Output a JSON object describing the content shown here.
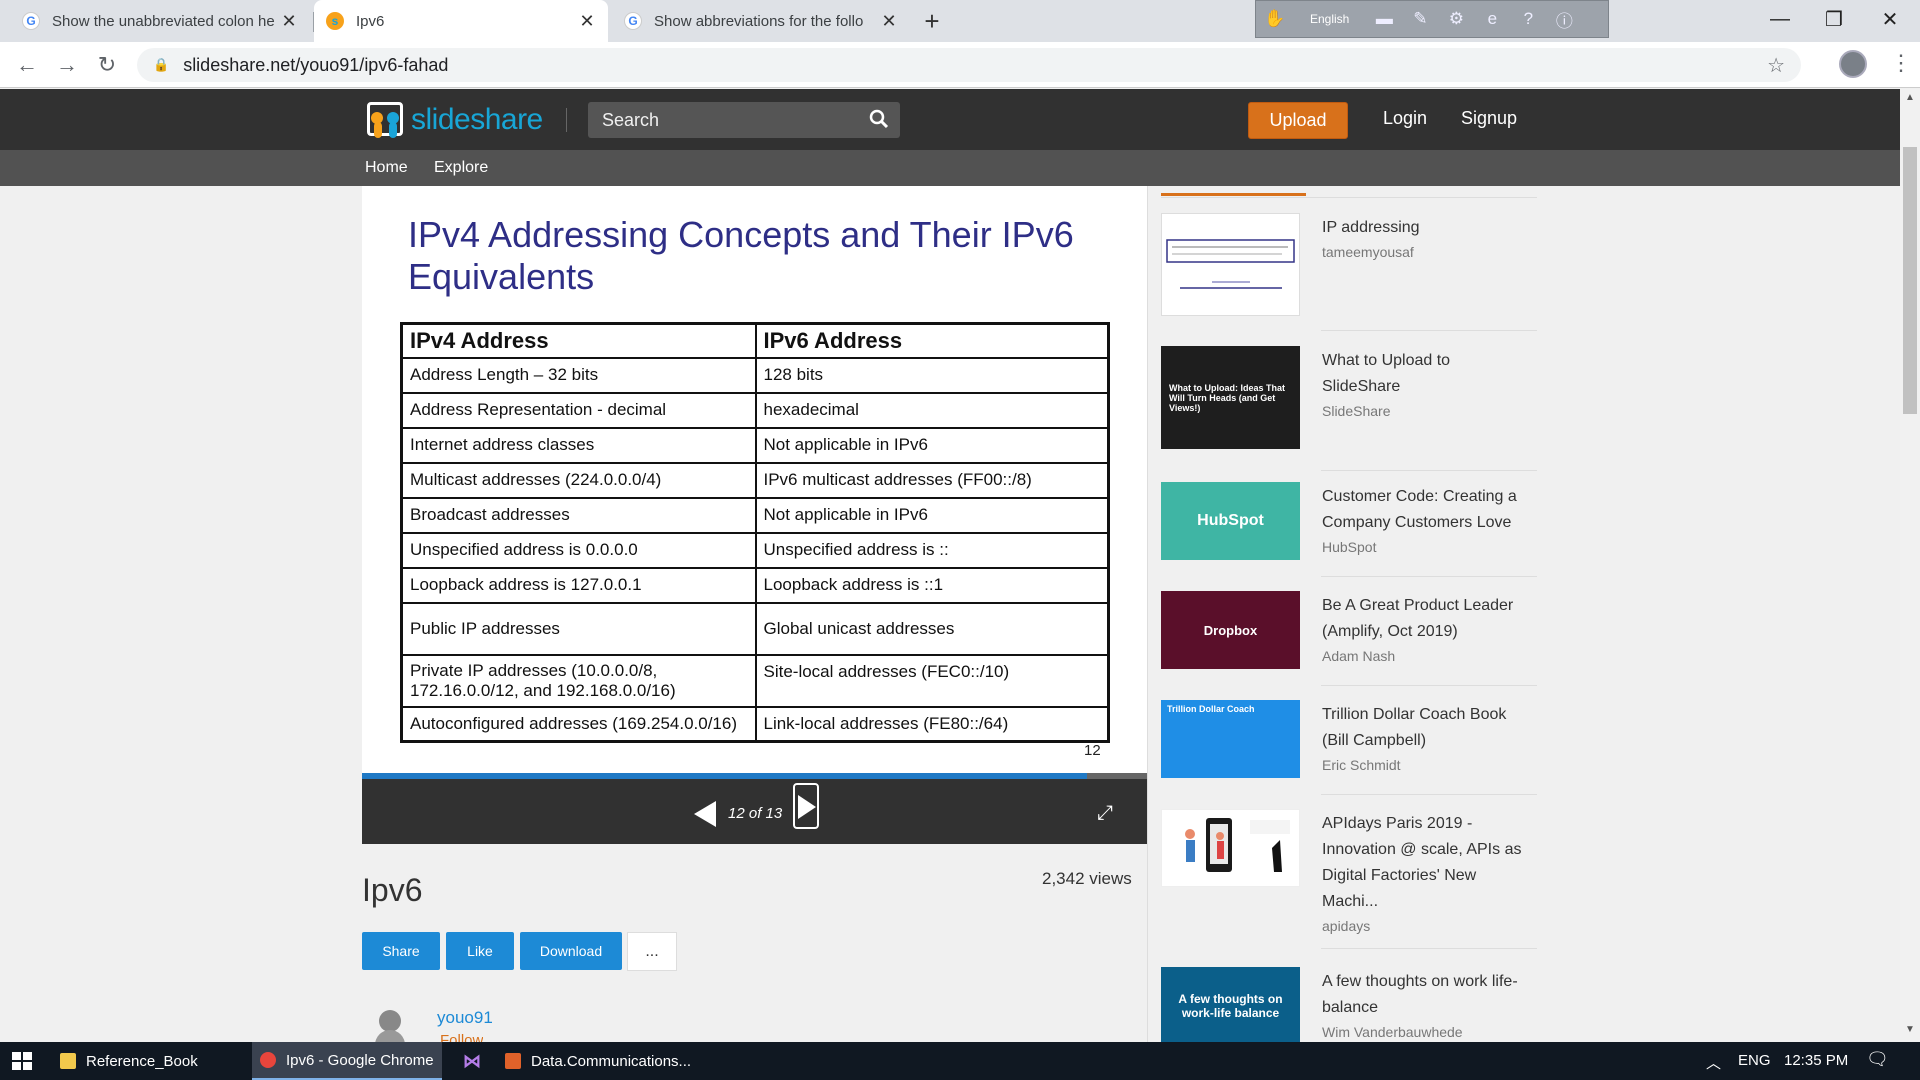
{
  "browser": {
    "tabs": [
      {
        "title": "Show the unabbreviated colon he",
        "favicon": "google-icon",
        "active": false
      },
      {
        "title": "Ipv6",
        "favicon": "slideshare-icon",
        "active": true
      },
      {
        "title": "Show abbreviations for the follo",
        "favicon": "google-icon",
        "active": false
      }
    ],
    "new_tab": "+",
    "ime_language": "English",
    "url": "slideshare.net/youo91/ipv6-fahad"
  },
  "site": {
    "logo_text": "slideshare",
    "search_placeholder": "Search",
    "upload_label": "Upload",
    "login_label": "Login",
    "signup_label": "Signup",
    "nav": [
      "Home",
      "Explore"
    ]
  },
  "slide": {
    "title": "IPv4 Addressing Concepts and Their IPv6 Equivalents",
    "headers": [
      "IPv4 Address",
      "IPv6 Address"
    ],
    "rows": [
      [
        "Address Length – 32 bits",
        "128 bits"
      ],
      [
        "Address Representation - decimal",
        "hexadecimal"
      ],
      [
        "Internet address classes",
        "Not applicable in IPv6"
      ],
      [
        "Multicast addresses (224.0.0.0/4)",
        "IPv6 multicast addresses (FF00::/8)"
      ],
      [
        "Broadcast addresses",
        "Not applicable in IPv6"
      ],
      [
        "Unspecified address is 0.0.0.0",
        "Unspecified address is ::"
      ],
      [
        "Loopback address is 127.0.0.1",
        "Loopback address is ::1"
      ],
      [
        "Public IP addresses",
        "Global unicast addresses"
      ],
      [
        "Private IP addresses (10.0.0.0/8, 172.16.0.0/12, and 192.168.0.0/16)",
        "Site-local addresses (FEC0::/10)"
      ],
      [
        "Autoconfigured addresses (169.254.0.0/16)",
        "Link-local addresses (FE80::/64)"
      ]
    ],
    "page_number": "12"
  },
  "player": {
    "counter": "12 of 13",
    "progress_fraction": 0.923
  },
  "document": {
    "title": "Ipv6",
    "views": "2,342 views",
    "actions": [
      "Share",
      "Like",
      "Download"
    ],
    "more": "...",
    "author": "youo91",
    "follow": "Follow"
  },
  "related": [
    {
      "title": "IP addressing",
      "author": "tameemyousaf",
      "thumb_color": "#ffffff"
    },
    {
      "title": "What to Upload to SlideShare",
      "author": "SlideShare",
      "thumb_color": "#1e1e1e"
    },
    {
      "title": "Customer Code: Creating a Company Customers Love",
      "author": "HubSpot",
      "thumb_color": "#3fb5a4"
    },
    {
      "title": "Be A Great Product Leader (Amplify, Oct 2019)",
      "author": "Adam Nash",
      "thumb_color": "#5a0f2a"
    },
    {
      "title": "Trillion Dollar Coach Book (Bill Campbell)",
      "author": "Eric Schmidt",
      "thumb_color": "#1f8ee6"
    },
    {
      "title": "APIdays Paris 2019 - Innovation @ scale, APIs as Digital Factories' New Machi...",
      "author": "apidays",
      "thumb_color": "#ffffff"
    },
    {
      "title": "A few thoughts on work life-balance",
      "author": "Wim Vanderbauwhede",
      "thumb_color": "#0b5f8a"
    }
  ],
  "thumb_labels": {
    "what_to_upload": "What to Upload: Ideas That Will Turn Heads (and Get Views!)",
    "hubspot": "HubSpot",
    "dropbox": "Dropbox",
    "trillion": "Trillion Dollar Coach",
    "work_life": "A few thoughts on work-life balance"
  },
  "taskbar": {
    "items": [
      "Reference_Book",
      "Ipv6 - Google Chrome",
      "Data.Communications..."
    ],
    "lang": "ENG",
    "time": "12:35 PM"
  }
}
